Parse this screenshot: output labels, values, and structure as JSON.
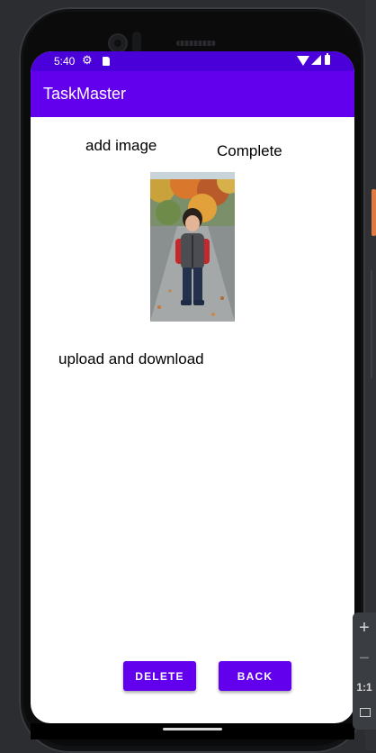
{
  "status_bar": {
    "time": "5:40",
    "icons": [
      "settings-icon",
      "sd-card-icon",
      "wifi-icon",
      "signal-icon",
      "battery-icon"
    ]
  },
  "app_bar": {
    "title": "TaskMaster",
    "color": "#6200ee"
  },
  "content": {
    "add_image_label": "add image",
    "status_label": "Complete",
    "image": {
      "description": "photo of a child standing on a path among autumn trees"
    },
    "upload_label": "upload and download"
  },
  "buttons": {
    "delete_label": "DELETE",
    "back_label": "BACK"
  },
  "emulator_controls": {
    "zoom_in": "+",
    "zoom_out": "−",
    "ratio": "1:1"
  },
  "colors": {
    "status_bar": "#4a00d9",
    "primary": "#6200ee"
  }
}
